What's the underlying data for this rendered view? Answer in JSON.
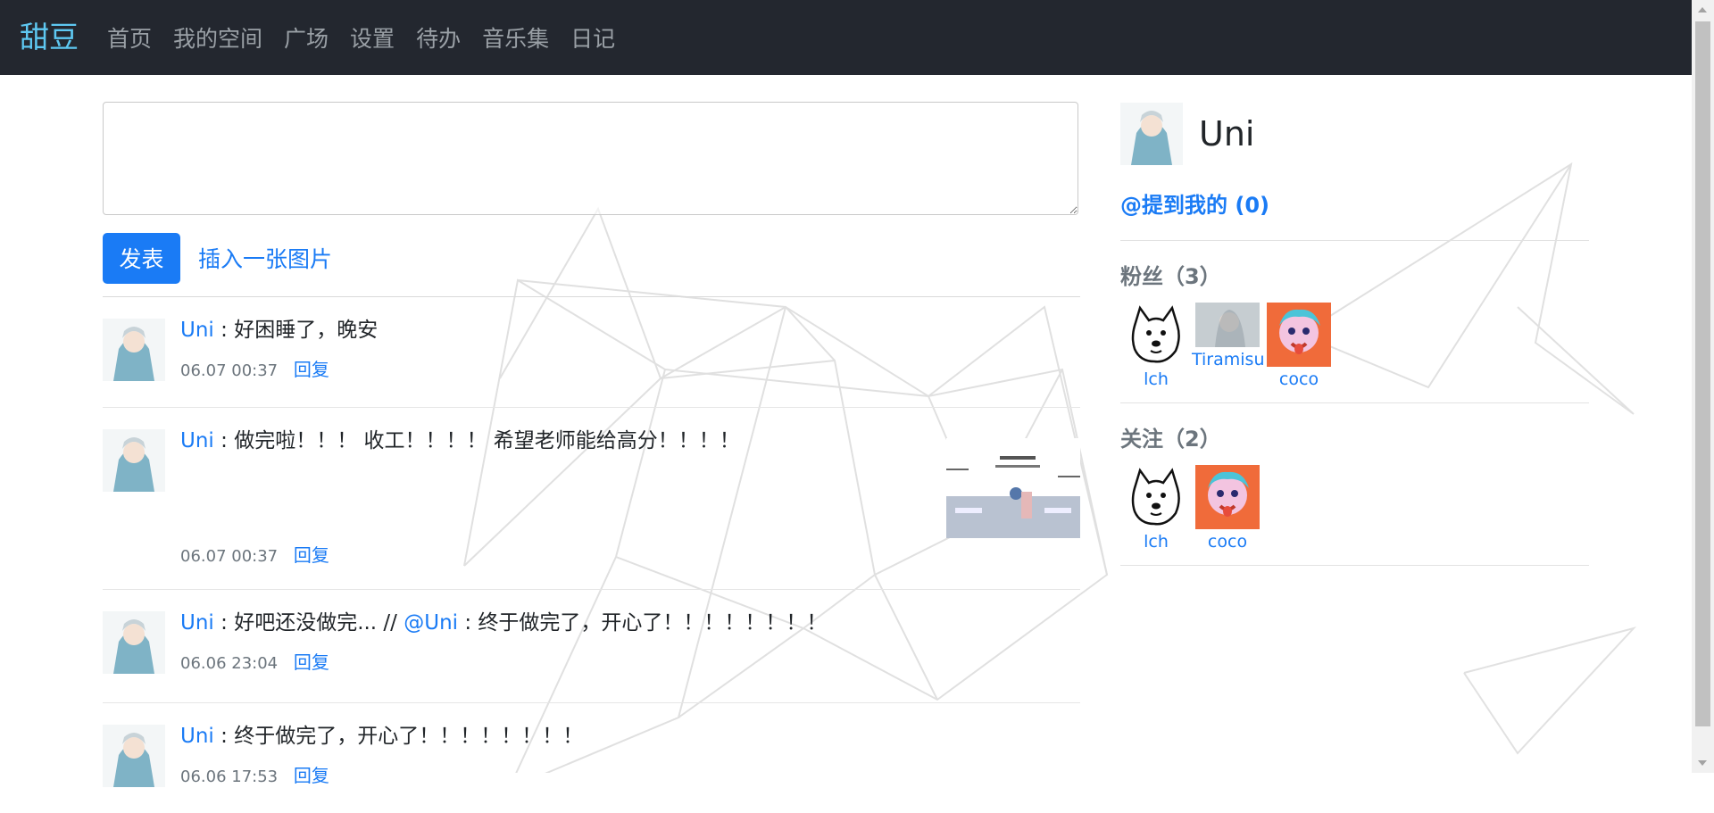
{
  "nav": {
    "brand": "甜豆",
    "items": [
      "首页",
      "我的空间",
      "广场",
      "设置",
      "待办",
      "音乐集",
      "日记"
    ]
  },
  "composer": {
    "post_label": "发表",
    "insert_image_label": "插入一张图片"
  },
  "posts": [
    {
      "user": "Uni",
      "sep": " : ",
      "content": "好困睡了，晚安",
      "time": "06.07 00:37",
      "reply": "回复"
    },
    {
      "user": "Uni",
      "sep": " : ",
      "content": "做完啦！！！ 收工！！！！ 希望老师能给高分！！！！",
      "time": "06.07 00:37",
      "reply": "回复"
    },
    {
      "user": "Uni",
      "sep": " : ",
      "content": "好吧还没做完... // ",
      "mention": "@Uni",
      "content2": " : 终于做完了，开心了！！！！！！！！",
      "time": "06.06 23:04",
      "reply": "回复"
    },
    {
      "user": "Uni",
      "sep": " : ",
      "content": "终于做完了，开心了！！！！！！！！",
      "time": "06.06 17:53",
      "reply": "回复"
    }
  ],
  "sidebar": {
    "username": "Uni",
    "mention_link": "@提到我的 (0)",
    "fans_title": "粉丝（3）",
    "fans": [
      "lch",
      "Tiramisu",
      "coco"
    ],
    "follow_title": "关注（2）",
    "following": [
      "lch",
      "coco"
    ]
  },
  "colors": {
    "navbar": "#23272f",
    "brand": "#5ec8f2",
    "accent": "#1a7bf5",
    "muted": "#6c757d"
  }
}
